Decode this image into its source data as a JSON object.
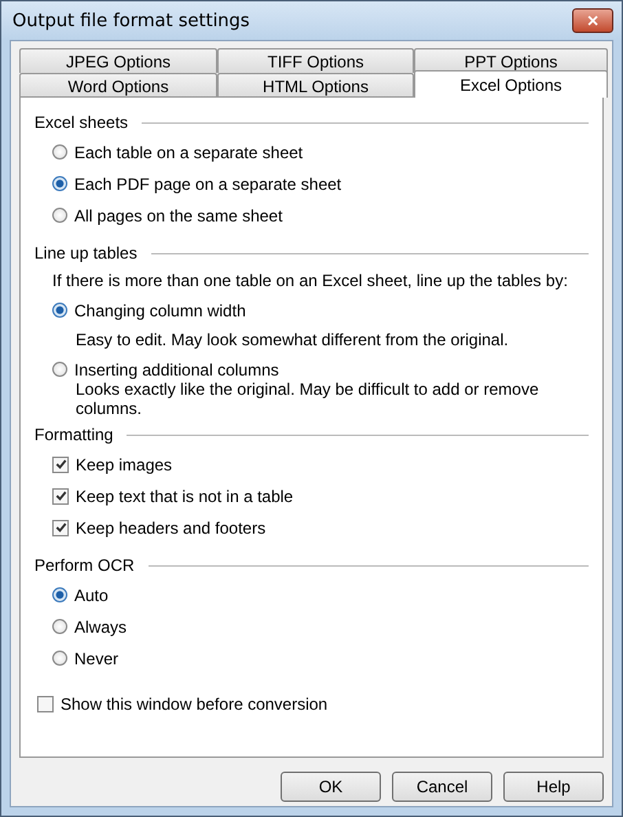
{
  "window": {
    "title": "Output file format settings",
    "close": "✕"
  },
  "tab_rows": [
    [
      {
        "label": "JPEG Options",
        "selected": false
      },
      {
        "label": "TIFF Options",
        "selected": false
      },
      {
        "label": "PPT Options",
        "selected": false
      }
    ],
    [
      {
        "label": "Word Options",
        "selected": false
      },
      {
        "label": "HTML Options",
        "selected": false
      },
      {
        "label": "Excel Options",
        "selected": true
      }
    ]
  ],
  "groups": [
    {
      "title": "Excel sheets",
      "items": [
        {
          "kind": "radio",
          "label": "Each table on a separate sheet",
          "selected": false
        },
        {
          "kind": "radio",
          "label": "Each PDF page on a separate sheet",
          "selected": true
        },
        {
          "kind": "radio",
          "label": "All pages on the same sheet",
          "selected": false
        }
      ]
    },
    {
      "title": "Line up tables",
      "items": [
        {
          "kind": "note",
          "label": "If there is more than one table on an Excel sheet, line up the tables by:"
        },
        {
          "kind": "radio",
          "label": "Changing column width",
          "selected": true
        },
        {
          "kind": "description",
          "label": "Easy to edit. May look somewhat different from the original."
        },
        {
          "kind": "radio",
          "label": "Inserting additional columns",
          "selected": false
        },
        {
          "kind": "description",
          "label": "Looks exactly like the original. May be difficult to add or remove columns."
        }
      ]
    },
    {
      "title": "Formatting",
      "items": [
        {
          "kind": "checkbox",
          "label": "Keep images",
          "checked": true
        },
        {
          "kind": "checkbox",
          "label": "Keep text that is not in a table",
          "checked": true
        },
        {
          "kind": "checkbox",
          "label": "Keep headers and footers",
          "checked": true
        }
      ]
    },
    {
      "title": "Perform OCR",
      "items": [
        {
          "kind": "radio",
          "label": "Auto",
          "selected": true
        },
        {
          "kind": "radio",
          "label": "Always",
          "selected": false
        },
        {
          "kind": "radio",
          "label": "Never",
          "selected": false
        }
      ]
    }
  ],
  "show_window": {
    "label": "Show this window before conversion",
    "checked": false
  },
  "buttons": [
    "OK",
    "Cancel",
    "Help"
  ]
}
